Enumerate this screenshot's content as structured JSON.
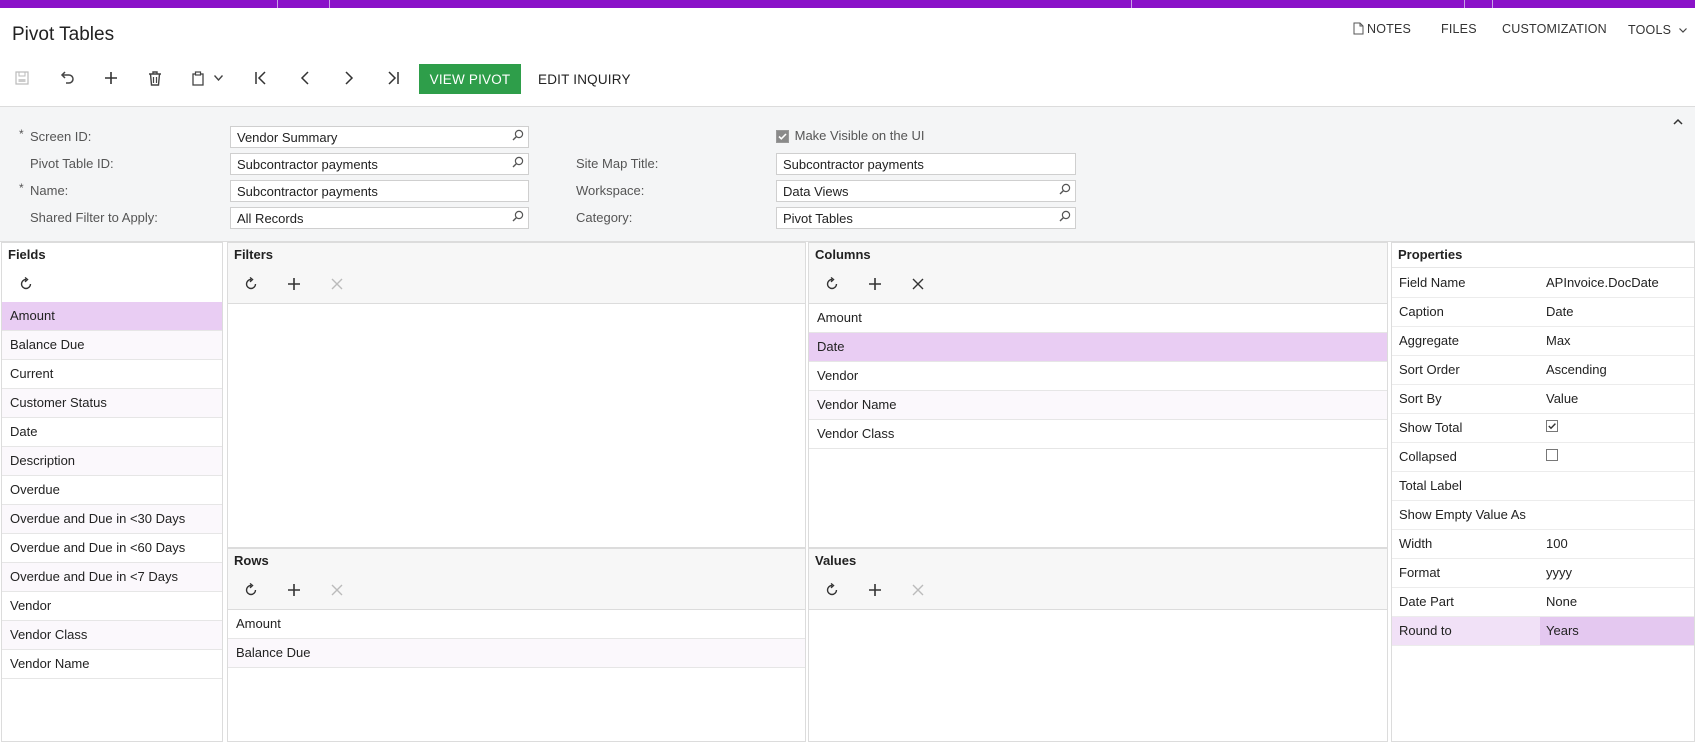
{
  "header": {
    "title": "Pivot Tables",
    "menu": {
      "notes": "NOTES",
      "files": "FILES",
      "customization": "CUSTOMIZATION",
      "tools": "TOOLS"
    }
  },
  "toolbar": {
    "view_pivot": "VIEW PIVOT",
    "edit_inquiry": "EDIT INQUIRY"
  },
  "form": {
    "screen_id_label": "Screen ID:",
    "screen_id_value": "Vendor Summary",
    "pivot_table_id_label": "Pivot Table ID:",
    "pivot_table_id_value": "Subcontractor payments",
    "name_label": "Name:",
    "name_value": "Subcontractor payments",
    "shared_filter_label": "Shared Filter to Apply:",
    "shared_filter_value": "All Records",
    "make_visible_label": "Make Visible on the UI",
    "make_visible_checked": true,
    "site_map_title_label": "Site Map Title:",
    "site_map_title_value": "Subcontractor payments",
    "workspace_label": "Workspace:",
    "workspace_value": "Data Views",
    "category_label": "Category:",
    "category_value": "Pivot Tables"
  },
  "fields": {
    "title": "Fields",
    "items": [
      "Amount",
      "Balance Due",
      "Current",
      "Customer Status",
      "Date",
      "Description",
      "Overdue",
      "Overdue and Due in <30 Days",
      "Overdue and Due in <60 Days",
      "Overdue and Due in <7 Days",
      "Vendor",
      "Vendor Class",
      "Vendor Name"
    ]
  },
  "filters": {
    "title": "Filters"
  },
  "columns": {
    "title": "Columns",
    "items": [
      "Amount",
      "Date",
      "Vendor",
      "Vendor Name",
      "Vendor Class"
    ]
  },
  "rows": {
    "title": "Rows",
    "items": [
      "Amount",
      "Balance Due"
    ]
  },
  "values": {
    "title": "Values"
  },
  "properties": {
    "title": "Properties",
    "rows": [
      {
        "key": "Field Name",
        "value": "APInvoice.DocDate"
      },
      {
        "key": "Caption",
        "value": "Date"
      },
      {
        "key": "Aggregate",
        "value": "Max"
      },
      {
        "key": "Sort Order",
        "value": "Ascending"
      },
      {
        "key": "Sort By",
        "value": "Value"
      },
      {
        "key": "Show Total",
        "value": ""
      },
      {
        "key": "Collapsed",
        "value": ""
      },
      {
        "key": "Total Label",
        "value": ""
      },
      {
        "key": "Show Empty Value As",
        "value": ""
      },
      {
        "key": "Width",
        "value": "100"
      },
      {
        "key": "Format",
        "value": "yyyy"
      },
      {
        "key": "Date Part",
        "value": "None"
      },
      {
        "key": "Round to",
        "value": "Years"
      }
    ],
    "show_total_checked": true,
    "collapsed_checked": false
  },
  "colors": {
    "accent": "#8a12c8",
    "view_pivot_bg": "#2e9e4a",
    "selected_row": "#e9cdf3"
  }
}
